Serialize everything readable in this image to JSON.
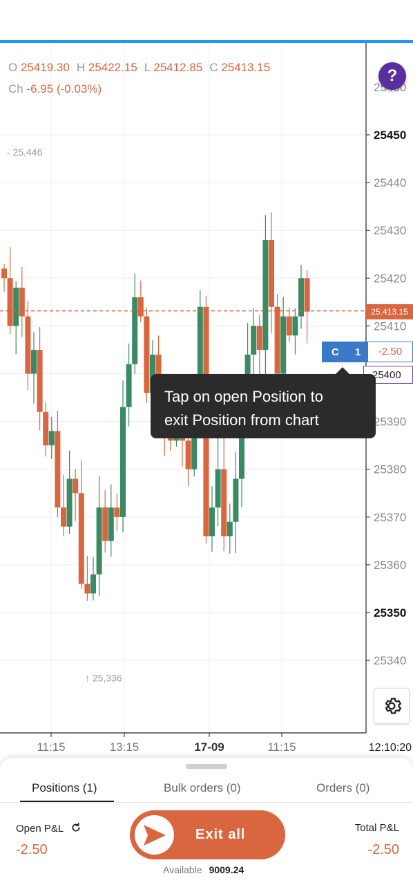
{
  "ohlc": {
    "o_label": "O",
    "o": "25419.30",
    "h_label": "H",
    "h": "25422.15",
    "l_label": "L",
    "l": "25412.85",
    "c_label": "C",
    "c": "25413.15",
    "ch_label": "Ch",
    "ch": "-6.95 (-0.03%)"
  },
  "help": {
    "label": "?"
  },
  "chart_data": {
    "type": "candlestick",
    "y_ticks": [
      "25450",
      "25440",
      "25430",
      "25420",
      "25410",
      "25400",
      "25390",
      "25380",
      "25370",
      "25360",
      "25350",
      "25340"
    ],
    "top_tick_partial": "25460",
    "x_ticks": [
      "11:15",
      "13:15",
      "17-09",
      "11:15"
    ],
    "time_label": "12:10:20",
    "high_marker": "25,446",
    "low_marker": "25,336",
    "current_price": "25,413.15",
    "position_price": "25400",
    "colors": {
      "up": "#3a8a64",
      "down": "#d9663e"
    }
  },
  "position": {
    "c_label": "C",
    "qty": "1",
    "pnl": "-2.50"
  },
  "tooltip": {
    "line1": "Tap on open Position to",
    "line2": "exit Position from chart"
  },
  "tabs": {
    "positions": "Positions (1)",
    "bulk": "Bulk orders (0)",
    "orders": "Orders (0)"
  },
  "summary": {
    "open_pl_label": "Open P&L",
    "open_pl": "-2.50",
    "total_pl_label": "Total P&L",
    "total_pl": "-2.50"
  },
  "exit": {
    "label": "Exit all"
  },
  "available": {
    "label": "Available",
    "value": "9009.24"
  }
}
